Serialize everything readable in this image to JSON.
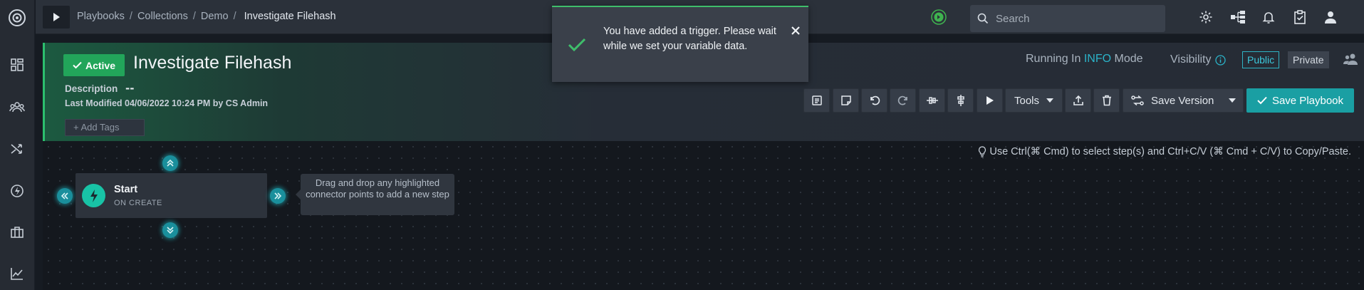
{
  "breadcrumb": [
    "Playbooks",
    "Collections",
    "Demo",
    "Investigate Filehash"
  ],
  "search": {
    "placeholder": "Search"
  },
  "toast": {
    "message": "You have added a trigger. Please wait while we set your variable data."
  },
  "header": {
    "status": "Active",
    "title": "Investigate Filehash",
    "description_label": "Description",
    "description_value": "--",
    "last_modified": "Last Modified 04/06/2022 10:24 PM by CS Admin",
    "add_tags": "+ Add Tags",
    "running_prefix": "Running In",
    "running_mode": "INFO",
    "running_suffix": "Mode",
    "visibility_label": "Visibility",
    "public": "Public",
    "private": "Private"
  },
  "toolbar": {
    "tools": "Tools",
    "save_version": "Save Version",
    "save_playbook": "Save Playbook"
  },
  "canvas": {
    "hint": "Use Ctrl(⌘ Cmd) to select step(s) and Ctrl+C/V (⌘ Cmd + C/V) to Copy/Paste.",
    "start_name": "Start",
    "start_sub": "ON CREATE",
    "tip": "Drag and drop any highlighted connector points to add a new step"
  },
  "colors": {
    "accent": "#1a9fa3",
    "active": "#22a55a",
    "connector": "#1a8f9c"
  }
}
